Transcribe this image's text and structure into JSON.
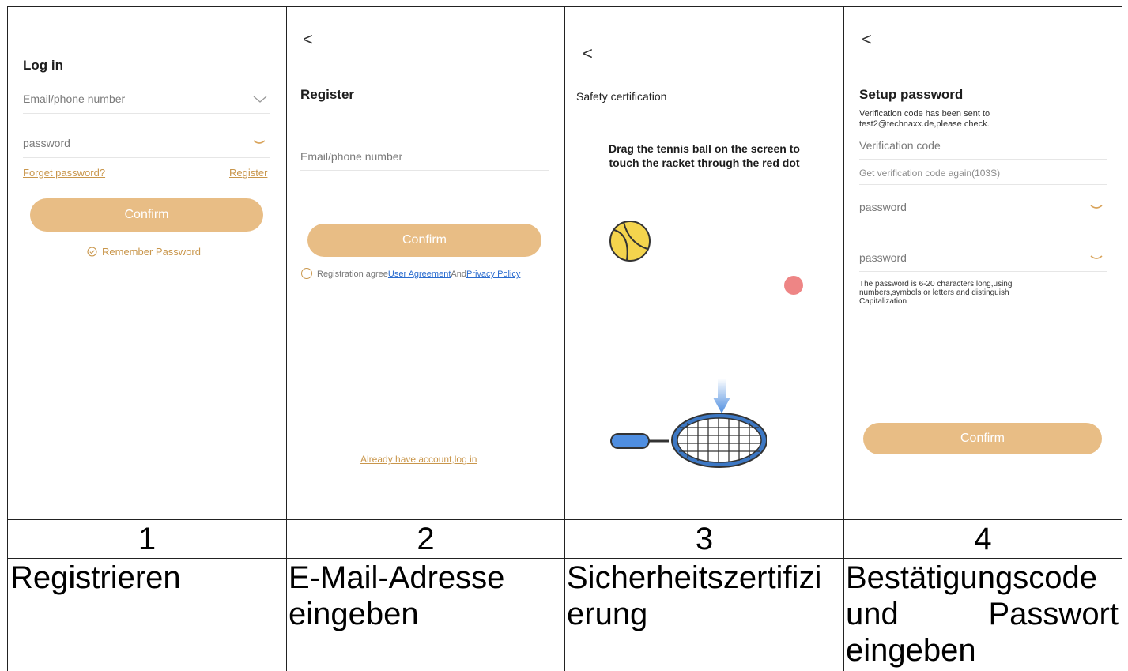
{
  "screens": [
    {
      "title": "Log in",
      "email_placeholder": "Email/phone number",
      "password_placeholder": "password",
      "forget_link": "Forget password?",
      "register_link": "Register",
      "confirm": "Confirm",
      "remember": "Remember Password"
    },
    {
      "back": "<",
      "title": "Register",
      "email_placeholder": "Email/phone number",
      "confirm": "Confirm",
      "agree_prefix": "Registration agree",
      "user_agreement": "User Agreement",
      "and": "And",
      "privacy_policy": "Privacy Policy",
      "login_link": "Already have account,log in"
    },
    {
      "back": "<",
      "title": "Safety certification",
      "instruction_line1": "Drag the tennis ball on the screen to",
      "instruction_line2": "touch the racket through the red dot"
    },
    {
      "back": "<",
      "title": "Setup password",
      "sent_line1": "Verification code has been sent to",
      "sent_line2": "test2@technaxx.de,please check.",
      "code_placeholder": "Verification code",
      "resend": "Get verification code again(103S)",
      "password_placeholder": "password",
      "password2_placeholder": "password",
      "hint_line1": "The password is 6-20 characters long,using",
      "hint_line2": "numbers,symbols or letters and distinguish",
      "hint_line3": "Capitalization",
      "confirm": "Confirm"
    }
  ],
  "steps": [
    "1",
    "2",
    "3",
    "4"
  ],
  "captions": [
    {
      "line1": "Registrieren",
      "line2": "",
      "line3": ""
    },
    {
      "line1": "E-Mail-Adresse",
      "line2": "eingeben",
      "line3": ""
    },
    {
      "line1": "Sicherheitszertifizi",
      "line2": "erung",
      "line3": ""
    },
    {
      "line1": "Bestätigungscode",
      "line2a": "und",
      "line2b": "Passwort",
      "line3": "eingeben"
    }
  ],
  "colors": {
    "accent": "#e8bd85",
    "link_gold": "#c9964b",
    "link_blue": "#2a6ccf",
    "ball": "#f4d44d",
    "dot": "#ee8585",
    "racket": "#3d78c4"
  }
}
